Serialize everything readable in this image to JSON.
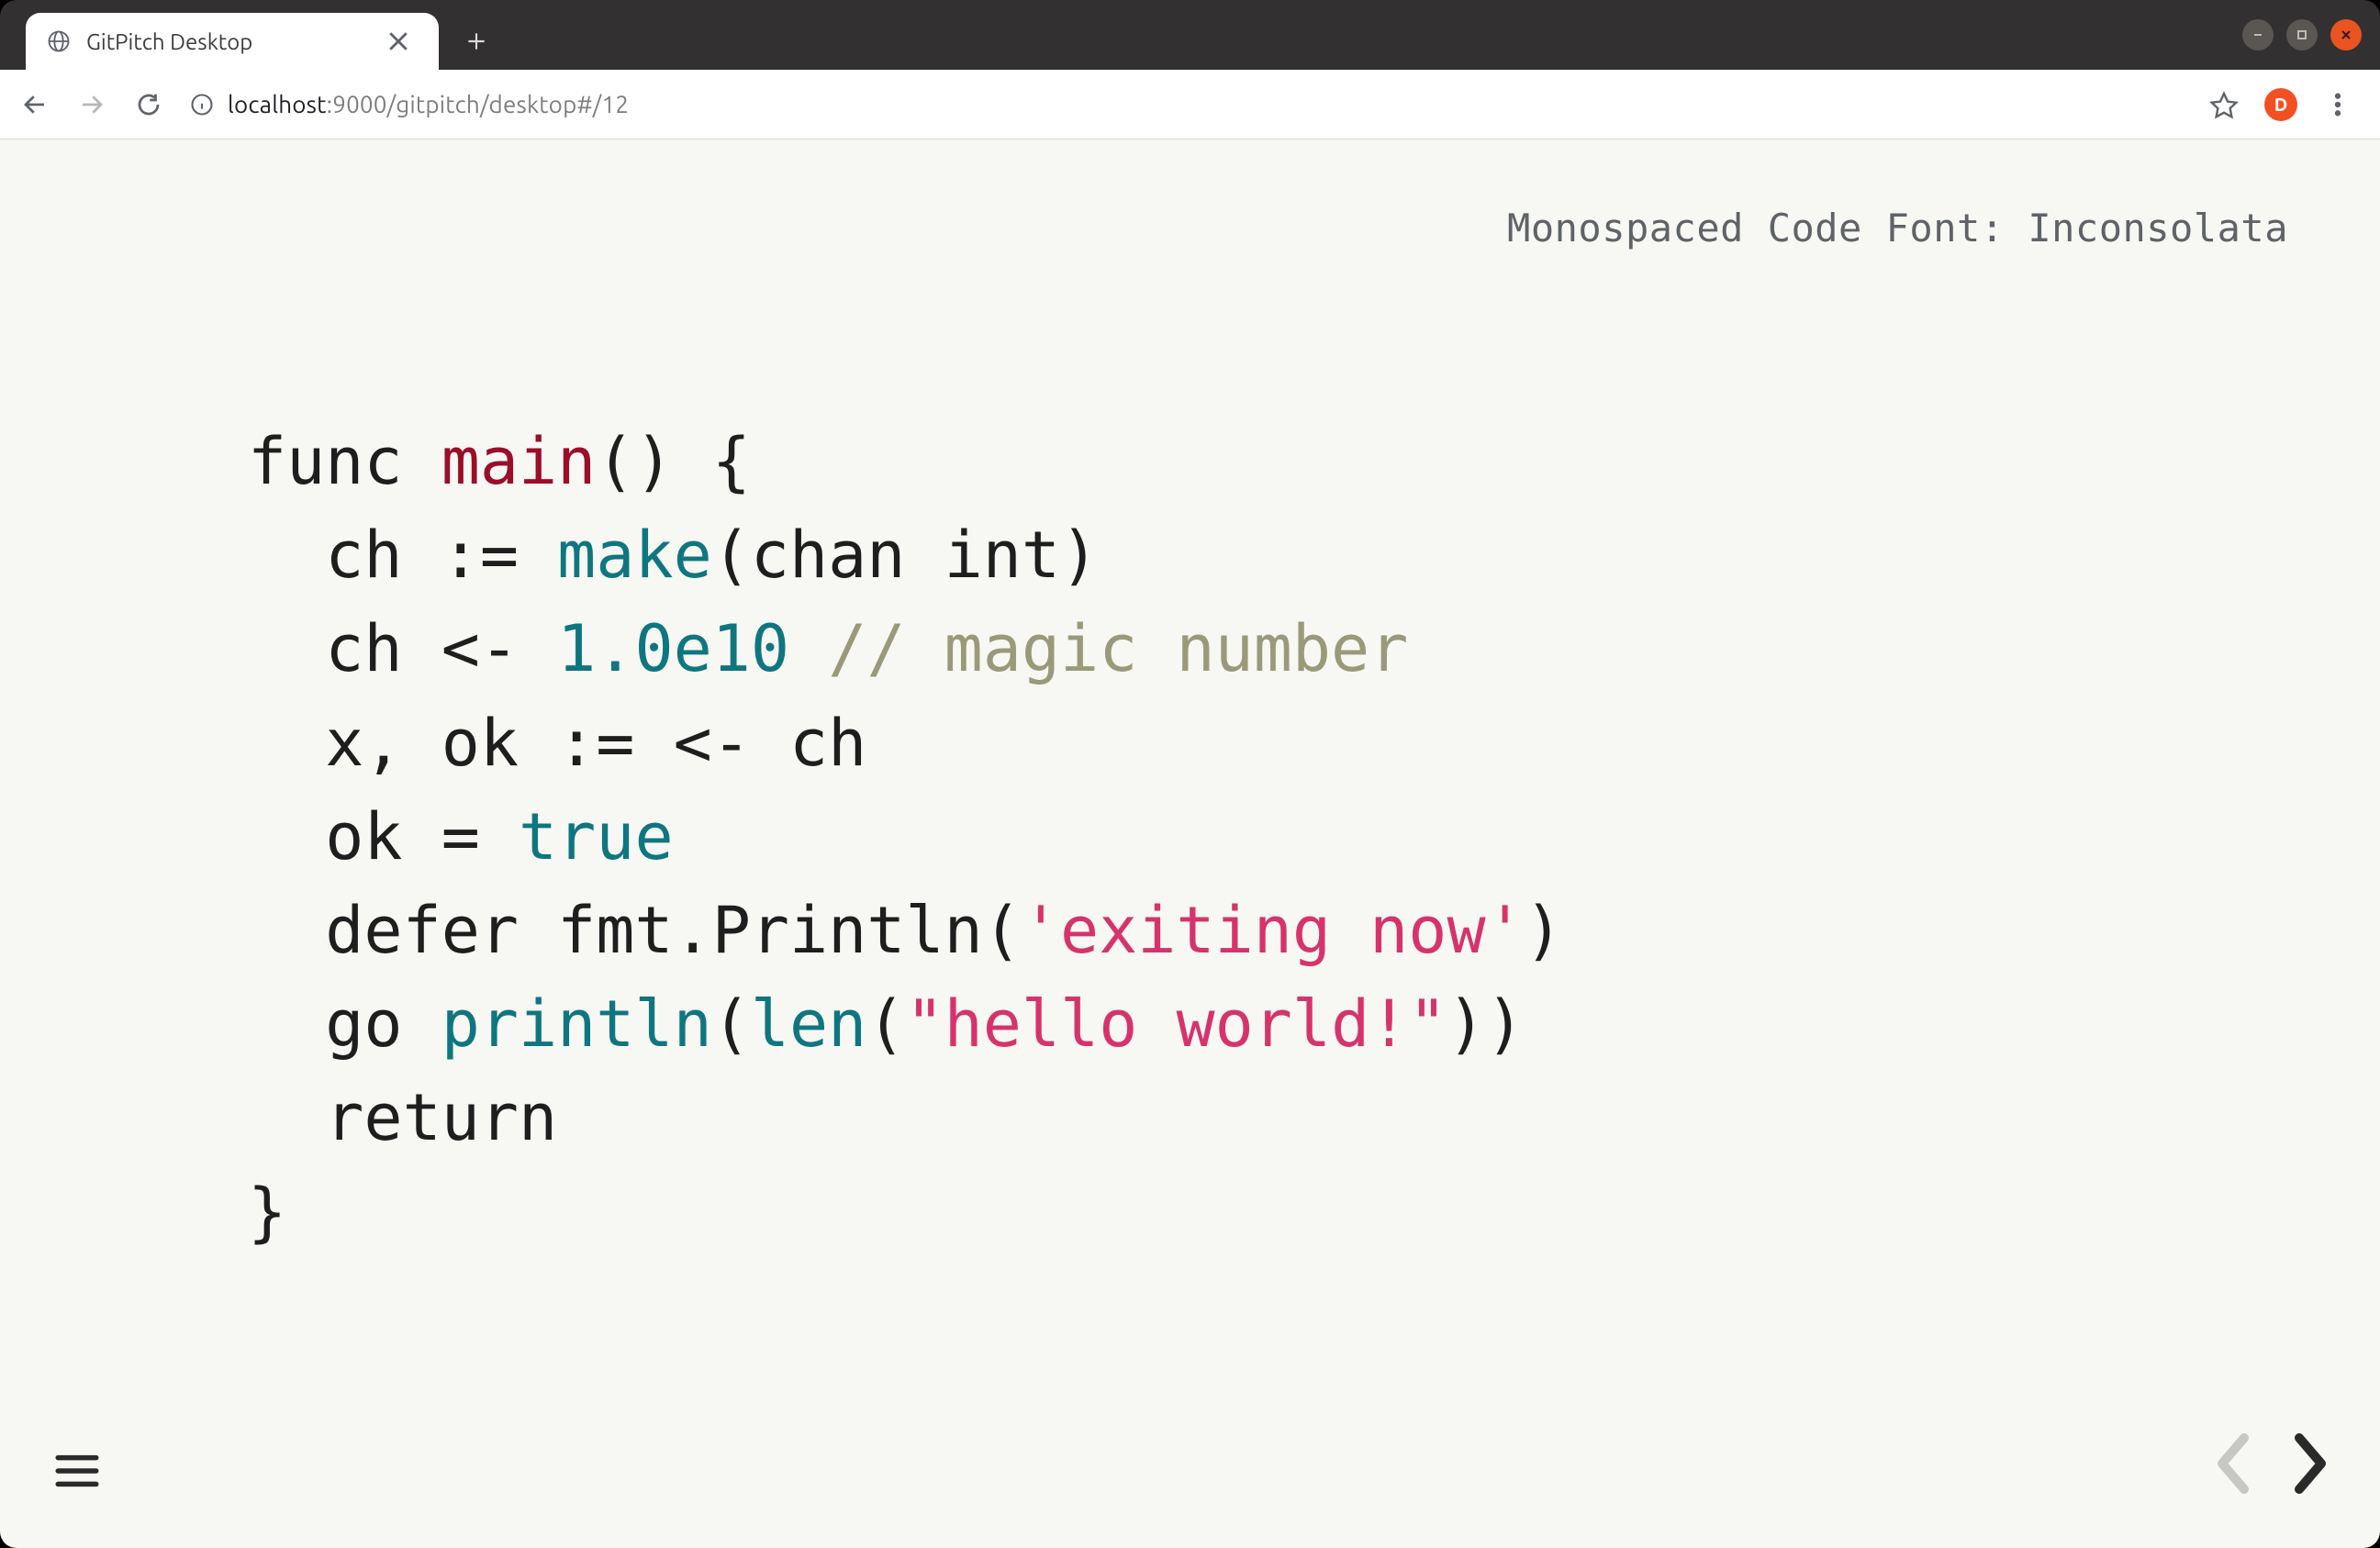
{
  "window": {
    "tab_title": "GitPitch Desktop",
    "profile_initial": "D"
  },
  "url": {
    "host": "localhost",
    "port_path": ":9000/gitpitch/desktop#/12"
  },
  "slide": {
    "heading": "Monospaced Code Font: Inconsolata",
    "code_tokens": [
      [
        {
          "cls": "tok-keyword",
          "t": "func"
        },
        {
          "cls": "tok-plain",
          "t": " "
        },
        {
          "cls": "tok-func",
          "t": "main"
        },
        {
          "cls": "tok-plain",
          "t": "() {"
        }
      ],
      [
        {
          "cls": "tok-plain",
          "t": "  ch := "
        },
        {
          "cls": "tok-builtin",
          "t": "make"
        },
        {
          "cls": "tok-plain",
          "t": "(chan int)"
        }
      ],
      [
        {
          "cls": "tok-plain",
          "t": "  ch <- "
        },
        {
          "cls": "tok-number",
          "t": "1.0e10"
        },
        {
          "cls": "tok-plain",
          "t": " "
        },
        {
          "cls": "tok-comment",
          "t": "// magic number"
        }
      ],
      [
        {
          "cls": "tok-plain",
          "t": "  x, ok := <- ch"
        }
      ],
      [
        {
          "cls": "tok-plain",
          "t": "  ok = "
        },
        {
          "cls": "tok-literal",
          "t": "true"
        }
      ],
      [
        {
          "cls": "tok-plain",
          "t": "  defer fmt.Println("
        },
        {
          "cls": "tok-string",
          "t": "'exiting now'"
        },
        {
          "cls": "tok-plain",
          "t": ")"
        }
      ],
      [
        {
          "cls": "tok-plain",
          "t": "  go "
        },
        {
          "cls": "tok-builtin",
          "t": "println"
        },
        {
          "cls": "tok-plain",
          "t": "("
        },
        {
          "cls": "tok-builtin",
          "t": "len"
        },
        {
          "cls": "tok-plain",
          "t": "("
        },
        {
          "cls": "tok-string",
          "t": "\"hello world!\""
        },
        {
          "cls": "tok-plain",
          "t": "))"
        }
      ],
      [
        {
          "cls": "tok-plain",
          "t": "  return"
        }
      ],
      [
        {
          "cls": "tok-plain",
          "t": "}"
        }
      ]
    ]
  }
}
